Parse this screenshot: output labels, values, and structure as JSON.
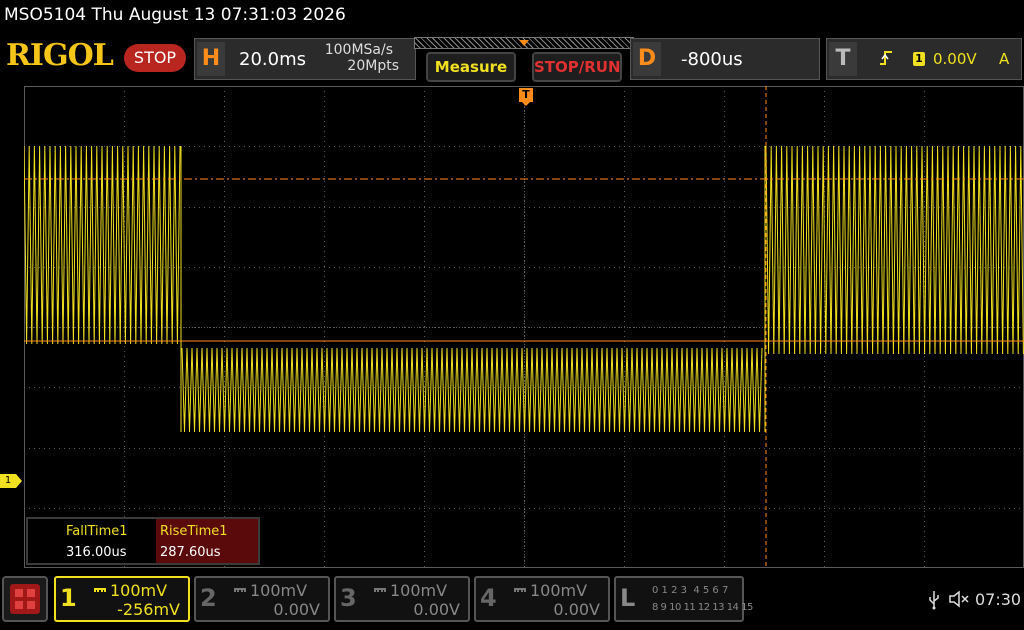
{
  "title": "MSO5104  Thu August 13 07:31:03 2026",
  "logo": "RIGOL",
  "run_state": "STOP",
  "horizontal": {
    "tag": "H",
    "timebase": "20.0ms",
    "sample_rate": "100MSa/s",
    "memory_depth": "20Mpts"
  },
  "buttons": {
    "measure": "Measure",
    "stop_run": "STOP/RUN"
  },
  "delay": {
    "tag": "D",
    "value": "-800us"
  },
  "trigger": {
    "tag": "T",
    "source_badge": "1",
    "level": "0.00V",
    "mode": "A"
  },
  "trigger_marker": "T",
  "channel_marker": "1",
  "measurements": [
    {
      "name": "FallTime1",
      "value": "316.00us"
    },
    {
      "name": "RiseTime1",
      "value": "287.60us"
    }
  ],
  "channels": [
    {
      "num": "1",
      "scale": "100mV",
      "offset": "-256mV"
    },
    {
      "num": "2",
      "scale": "100mV",
      "offset": "0.00V"
    },
    {
      "num": "3",
      "scale": "100mV",
      "offset": "0.00V"
    },
    {
      "num": "4",
      "scale": "100mV",
      "offset": "0.00V"
    }
  ],
  "logic": {
    "tag": "L",
    "row1": "0 1 2 3  4 5 6 7",
    "row2": "8 9 10 11 12 13 14 15"
  },
  "status": {
    "time": "07:30"
  },
  "colors": {
    "ch1": "#f0e020",
    "trigger": "#ff8c1a",
    "grid": "#5a5a5a",
    "stop": "#b8261f"
  }
}
